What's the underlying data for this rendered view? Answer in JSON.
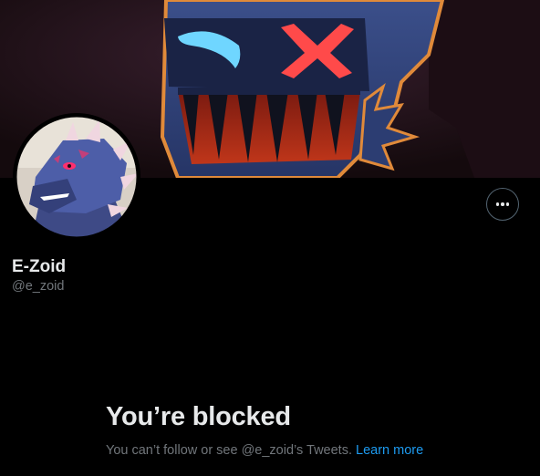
{
  "profile": {
    "display_name": "E-Zoid",
    "handle": "@e_zoid",
    "more_button_label": "More"
  },
  "blocked": {
    "title": "You’re blocked",
    "message": "You can’t follow or see @e_zoid’s Tweets.",
    "learn_more": "Learn more"
  },
  "icons": {
    "more": "more-horizontal-icon"
  },
  "colors": {
    "background": "#000000",
    "primary_text": "#e7e9ea",
    "secondary_text": "#71767b",
    "link": "#1d9bf0",
    "button_border": "#536471"
  }
}
